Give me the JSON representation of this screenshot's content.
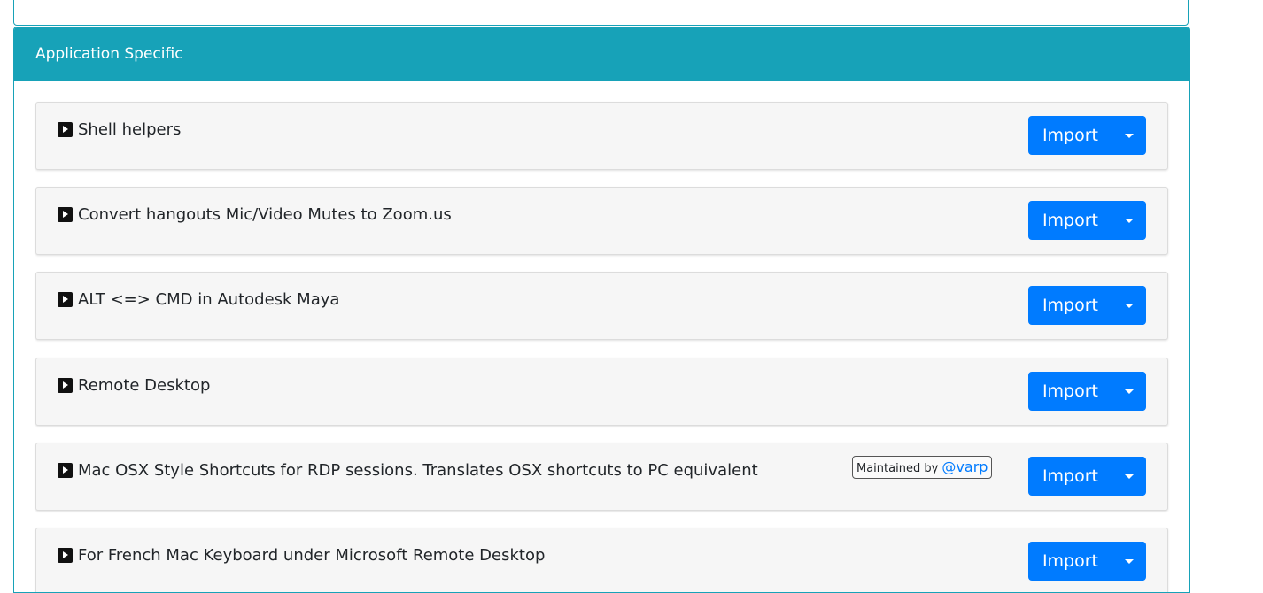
{
  "section": {
    "title": "Application Specific"
  },
  "rules": [
    {
      "title": "Shell helpers",
      "import_label": "Import"
    },
    {
      "title": "Convert hangouts Mic/Video Mutes to Zoom.us",
      "import_label": "Import"
    },
    {
      "title": "ALT <=> CMD in Autodesk Maya",
      "import_label": "Import"
    },
    {
      "title": "Remote Desktop",
      "import_label": "Import"
    },
    {
      "title": "Mac OSX Style Shortcuts for RDP sessions. Translates OSX shortcuts to PC equivalent",
      "import_label": "Import",
      "maintainer": {
        "prefix": "Maintained by ",
        "at": "@",
        "handle": "varp"
      }
    },
    {
      "title": "For French Mac Keyboard under Microsoft Remote Desktop",
      "import_label": "Import"
    }
  ],
  "colors": {
    "header_bg": "#17a2b8",
    "button_bg": "#007bff",
    "rule_bg": "#f6f6f6"
  },
  "icons": {
    "expand": "caret-right-square-icon",
    "dropdown": "chevron-down-icon"
  }
}
